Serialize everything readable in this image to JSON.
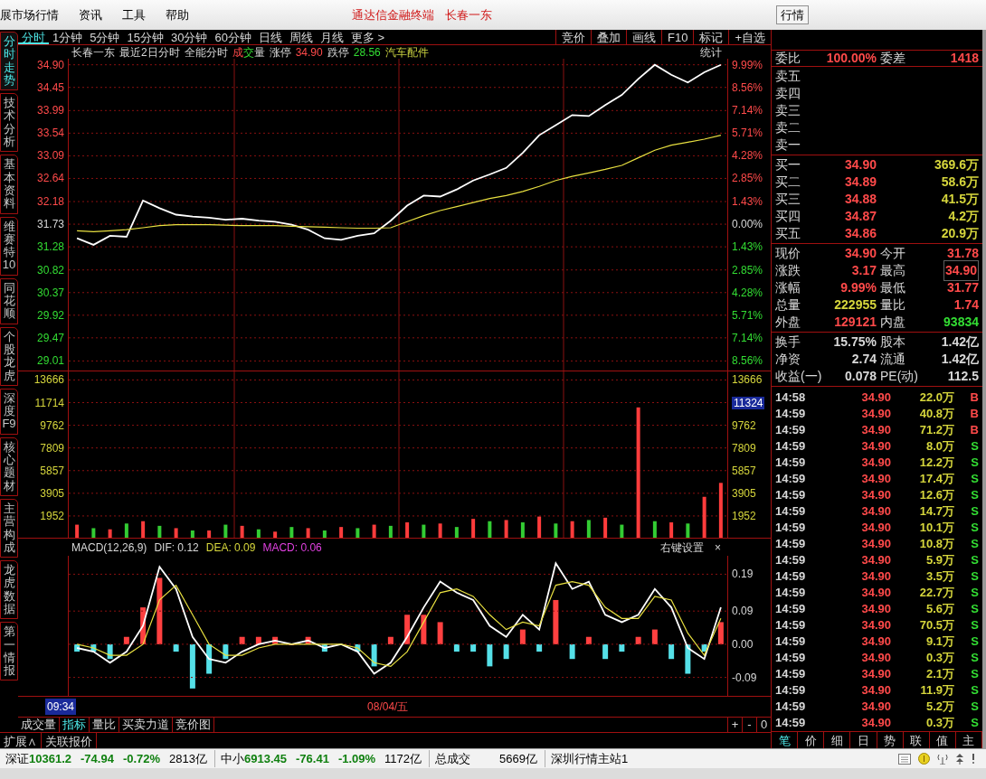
{
  "menu": {
    "items": [
      "展市场行情",
      "资讯",
      "工具",
      "帮助"
    ],
    "center": [
      "通达信金融终端",
      "长春一东"
    ],
    "button": "行情"
  },
  "side_tabs": [
    {
      "label": "分时走势",
      "selected": true
    },
    {
      "label": "技术分析",
      "selected": false
    },
    {
      "label": "基本资料",
      "selected": false
    },
    {
      "label": "维赛特10",
      "selected": false
    },
    {
      "label": "同花顺",
      "selected": false
    },
    {
      "label": "个股龙虎",
      "selected": false
    },
    {
      "label": "深度F9",
      "selected": false
    },
    {
      "label": "核心题材",
      "selected": false
    },
    {
      "label": "主营构成",
      "selected": false
    },
    {
      "label": "龙虎数据",
      "selected": false
    },
    {
      "label": "第一情报",
      "selected": false
    }
  ],
  "period_tabs": [
    {
      "label": "分时",
      "selected": true
    },
    {
      "label": "1分钟",
      "selected": false
    },
    {
      "label": "5分钟",
      "selected": false
    },
    {
      "label": "15分钟",
      "selected": false
    },
    {
      "label": "30分钟",
      "selected": false
    },
    {
      "label": "60分钟",
      "selected": false
    },
    {
      "label": "日线",
      "selected": false
    },
    {
      "label": "周线",
      "selected": false
    },
    {
      "label": "月线",
      "selected": false
    },
    {
      "label": "更多 >",
      "selected": false
    }
  ],
  "tool_buttons": [
    "竞价",
    "叠加",
    "画线",
    "F10",
    "标记",
    "+自选"
  ],
  "info_line": [
    {
      "parts": [
        {
          "text": "长春一东",
          "kind": "flat"
        }
      ]
    },
    {
      "parts": [
        {
          "text": "最近2日分时",
          "kind": "flat"
        }
      ]
    },
    {
      "parts": [
        {
          "text": "全能分时",
          "kind": "flat"
        }
      ]
    },
    {
      "parts": [
        {
          "text": "成",
          "kind": "up"
        },
        {
          "text": "交",
          "kind": "down"
        },
        {
          "text": "量",
          "kind": "flat"
        }
      ]
    },
    {
      "parts": [
        {
          "text": "涨停",
          "kind": "flat"
        }
      ]
    },
    {
      "parts": [
        {
          "text": "34.90",
          "kind": "up"
        }
      ]
    },
    {
      "parts": [
        {
          "text": "跌停",
          "kind": "flat"
        }
      ]
    },
    {
      "parts": [
        {
          "text": "28.56",
          "kind": "down"
        }
      ]
    },
    {
      "parts": [
        {
          "text": "汽车配件",
          "kind": "sector"
        }
      ]
    }
  ],
  "stats_button": "统计",
  "price_panel": {
    "right_axis": [
      {
        "label": "9.99%",
        "kind": "up"
      },
      {
        "label": "8.56%",
        "kind": "up"
      },
      {
        "label": "7.14%",
        "kind": "up"
      },
      {
        "label": "5.71%",
        "kind": "up"
      },
      {
        "label": "4.28%",
        "kind": "up"
      },
      {
        "label": "2.85%",
        "kind": "up"
      },
      {
        "label": "1.43%",
        "kind": "up"
      },
      {
        "label": "0.00%",
        "kind": "flat"
      },
      {
        "label": "1.43%",
        "kind": "down"
      },
      {
        "label": "2.85%",
        "kind": "down"
      },
      {
        "label": "4.28%",
        "kind": "down"
      },
      {
        "label": "5.71%",
        "kind": "down"
      },
      {
        "label": "7.14%",
        "kind": "down"
      },
      {
        "label": "8.56%",
        "kind": "down"
      }
    ],
    "chart_data": {
      "type": "line",
      "grid": true,
      "ylim": [
        28.82,
        35.02
      ],
      "yticks": [
        {
          "value": 34.9,
          "label": "34.90"
        },
        {
          "value": 34.45,
          "label": "34.45"
        },
        {
          "value": 33.99,
          "label": "33.99"
        },
        {
          "value": 33.54,
          "label": "33.54"
        },
        {
          "value": 33.09,
          "label": "33.09"
        },
        {
          "value": 32.64,
          "label": "32.64"
        },
        {
          "value": 32.18,
          "label": "32.18"
        },
        {
          "value": 31.73,
          "label": "31.73"
        },
        {
          "value": 31.28,
          "label": "31.28"
        },
        {
          "value": 30.82,
          "label": "30.82"
        },
        {
          "value": 30.37,
          "label": "30.37"
        },
        {
          "value": 29.92,
          "label": "29.92"
        },
        {
          "value": 29.47,
          "label": "29.47"
        },
        {
          "value": 29.01,
          "label": "29.01"
        }
      ],
      "series": [
        {
          "color": "#ffffff",
          "values": [
            31.45,
            31.32,
            31.5,
            31.48,
            32.2,
            32.05,
            31.92,
            31.88,
            31.86,
            31.82,
            31.84,
            31.8,
            31.78,
            31.72,
            31.62,
            31.45,
            31.42,
            31.5,
            31.55,
            31.8,
            32.1,
            32.3,
            32.28,
            32.42,
            32.6,
            32.72,
            32.85,
            33.15,
            33.5,
            33.7,
            33.9,
            33.88,
            34.1,
            34.3,
            34.62,
            34.9,
            34.7,
            34.55,
            34.75,
            34.9
          ]
        },
        {
          "color": "#e8e040",
          "values": [
            31.6,
            31.58,
            31.6,
            31.62,
            31.66,
            31.7,
            31.72,
            31.72,
            31.72,
            31.71,
            31.7,
            31.7,
            31.7,
            31.69,
            31.68,
            31.67,
            31.66,
            31.65,
            31.65,
            31.66,
            31.78,
            31.9,
            32.0,
            32.08,
            32.16,
            32.24,
            32.3,
            32.38,
            32.48,
            32.6,
            32.68,
            32.75,
            32.82,
            32.9,
            33.05,
            33.2,
            33.3,
            33.36,
            33.42,
            33.5
          ]
        }
      ]
    }
  },
  "volume_panel": {
    "right_axis": [
      {
        "label": "13666",
        "highlighted": false
      },
      {
        "label": "11324",
        "highlighted": true
      },
      {
        "label": "9762",
        "highlighted": false
      },
      {
        "label": "7809",
        "highlighted": false
      },
      {
        "label": "5857",
        "highlighted": false
      },
      {
        "label": "3905",
        "highlighted": false
      },
      {
        "label": "1952",
        "highlighted": false
      }
    ],
    "chart_data": {
      "type": "bar",
      "stacked": true,
      "grid": true,
      "ylim": [
        0,
        14400
      ],
      "yticks": [
        {
          "value": 13666,
          "label": "13666"
        },
        {
          "value": 11714,
          "label": "11714"
        },
        {
          "value": 9762,
          "label": "9762"
        },
        {
          "value": 7809,
          "label": "7809"
        },
        {
          "value": 5857,
          "label": "5857"
        },
        {
          "value": 3905,
          "label": "3905"
        },
        {
          "value": 1952,
          "label": "1952"
        }
      ],
      "series": [
        {
          "color": "#ff3c3c",
          "values": [
            1200,
            null,
            800,
            null,
            1500,
            null,
            900,
            null,
            700,
            null,
            1100,
            null,
            600,
            null,
            900,
            null,
            1000,
            null,
            1200,
            null,
            1400,
            null,
            1300,
            null,
            1700,
            null,
            1600,
            null,
            1900,
            null,
            1500,
            null,
            1800,
            null,
            11300,
            null,
            1400,
            null,
            3600,
            4800
          ]
        },
        {
          "color": "#33cc33",
          "values": [
            null,
            900,
            null,
            1300,
            null,
            1100,
            null,
            700,
            null,
            1200,
            null,
            800,
            null,
            1000,
            null,
            700,
            null,
            900,
            null,
            1100,
            null,
            1200,
            null,
            1000,
            null,
            1500,
            null,
            1400,
            null,
            1300,
            null,
            1600,
            null,
            1200,
            null,
            1500,
            null,
            1300,
            null,
            null
          ]
        }
      ]
    }
  },
  "macd_panel": {
    "title": "MACD(12,26,9)",
    "readings": [
      {
        "text": "DIF: 0.12",
        "kind": "flat"
      },
      {
        "text": "DEA: 0.09",
        "kind": "volume"
      },
      {
        "text": "MACD: 0.06",
        "kind": "magenta"
      }
    ],
    "settings": "右键设置",
    "close": "×",
    "chart_data": {
      "type": "line",
      "grid": true,
      "ylim": [
        -0.14,
        0.24
      ],
      "yticks": [
        {
          "value": 0.19,
          "label": "0.19"
        },
        {
          "value": 0.09,
          "label": "0.09"
        },
        {
          "value": 0,
          "label": "0.00"
        },
        {
          "value": -0.09,
          "label": "-0.09"
        }
      ],
      "series": [
        {
          "color": "#ffffff",
          "values": [
            -0.01,
            -0.02,
            -0.05,
            -0.02,
            0.05,
            0.21,
            0.15,
            0.02,
            -0.04,
            -0.05,
            -0.02,
            0.0,
            0.01,
            0.0,
            0.01,
            -0.01,
            0.0,
            -0.02,
            -0.08,
            -0.05,
            0.02,
            0.1,
            0.17,
            0.14,
            0.12,
            0.05,
            0.02,
            0.08,
            0.04,
            0.22,
            0.15,
            0.17,
            0.08,
            0.06,
            0.08,
            0.15,
            0.1,
            -0.01,
            -0.04,
            0.1
          ]
        },
        {
          "color": "#e8e040",
          "values": [
            0.0,
            -0.01,
            -0.03,
            -0.03,
            0.0,
            0.12,
            0.16,
            0.08,
            0.0,
            -0.03,
            -0.03,
            -0.01,
            0.0,
            0.0,
            0.0,
            0.0,
            0.0,
            -0.01,
            -0.05,
            -0.06,
            -0.02,
            0.06,
            0.14,
            0.15,
            0.13,
            0.08,
            0.04,
            0.06,
            0.05,
            0.16,
            0.17,
            0.16,
            0.1,
            0.07,
            0.07,
            0.13,
            0.12,
            0.03,
            -0.03,
            0.07
          ]
        }
      ]
    }
  },
  "time_axis": {
    "cursor": "09:34",
    "date": "08/04/五"
  },
  "bottom_tabs": [
    {
      "label": "成交量",
      "selected": false
    },
    {
      "label": "指标",
      "selected": true
    },
    {
      "label": "量比",
      "selected": false
    },
    {
      "label": "买卖力道",
      "selected": false
    },
    {
      "label": "竞价图",
      "selected": false
    }
  ],
  "zoom_buttons": [
    "+",
    "-",
    "0"
  ],
  "extension_tabs": [
    "扩展∧",
    "关联报价"
  ],
  "order_book": {
    "ratio": [
      {
        "label": "委比",
        "value": "100.00%"
      },
      {
        "label": "委差",
        "value": "1418"
      }
    ],
    "sell": [
      "卖五",
      "卖四",
      "卖三",
      "卖二",
      "卖一"
    ],
    "buy": [
      {
        "label": "买一",
        "price": "34.90",
        "volume": "369.6万"
      },
      {
        "label": "买二",
        "price": "34.89",
        "volume": "58.6万"
      },
      {
        "label": "买三",
        "price": "34.88",
        "volume": "41.5万"
      },
      {
        "label": "买四",
        "price": "34.87",
        "volume": "4.2万"
      },
      {
        "label": "买五",
        "price": "34.86",
        "volume": "20.9万"
      }
    ]
  },
  "quote": [
    [
      {
        "label": "现价",
        "value": "34.90",
        "kind": "up",
        "boxed": false
      },
      {
        "label": "今开",
        "value": "31.78",
        "kind": "up",
        "boxed": false
      }
    ],
    [
      {
        "label": "涨跌",
        "value": "3.17",
        "kind": "up",
        "boxed": false
      },
      {
        "label": "最高",
        "value": "34.90",
        "kind": "up",
        "boxed": true
      }
    ],
    [
      {
        "label": "涨幅",
        "value": "9.99%",
        "kind": "up",
        "boxed": false
      },
      {
        "label": "最低",
        "value": "31.77",
        "kind": "up",
        "boxed": false
      }
    ],
    [
      {
        "label": "总量",
        "value": "222955",
        "kind": "volume",
        "boxed": false
      },
      {
        "label": "量比",
        "value": "1.74",
        "kind": "up",
        "boxed": false
      }
    ],
    [
      {
        "label": "外盘",
        "value": "129121",
        "kind": "up",
        "boxed": false
      },
      {
        "label": "内盘",
        "value": "93834",
        "kind": "down",
        "boxed": false
      }
    ]
  ],
  "fundamentals": [
    [
      {
        "label": "换手",
        "value": "15.75%"
      },
      {
        "label": "股本",
        "value": "1.42亿"
      }
    ],
    [
      {
        "label": "净资",
        "value": "2.74"
      },
      {
        "label": "流通",
        "value": "1.42亿"
      }
    ],
    [
      {
        "label": "收益(一)",
        "value": "0.078"
      },
      {
        "label": "PE(动)",
        "value": "112.5"
      }
    ]
  ],
  "ticks": [
    {
      "time": "14:58",
      "price": "34.90",
      "volume": "22.0万",
      "side": "B"
    },
    {
      "time": "14:59",
      "price": "34.90",
      "volume": "40.8万",
      "side": "B"
    },
    {
      "time": "14:59",
      "price": "34.90",
      "volume": "71.2万",
      "side": "B"
    },
    {
      "time": "14:59",
      "price": "34.90",
      "volume": "8.0万",
      "side": "S"
    },
    {
      "time": "14:59",
      "price": "34.90",
      "volume": "12.2万",
      "side": "S"
    },
    {
      "time": "14:59",
      "price": "34.90",
      "volume": "17.4万",
      "side": "S"
    },
    {
      "time": "14:59",
      "price": "34.90",
      "volume": "12.6万",
      "side": "S"
    },
    {
      "time": "14:59",
      "price": "34.90",
      "volume": "14.7万",
      "side": "S"
    },
    {
      "time": "14:59",
      "price": "34.90",
      "volume": "10.1万",
      "side": "S"
    },
    {
      "time": "14:59",
      "price": "34.90",
      "volume": "10.8万",
      "side": "S"
    },
    {
      "time": "14:59",
      "price": "34.90",
      "volume": "5.9万",
      "side": "S"
    },
    {
      "time": "14:59",
      "price": "34.90",
      "volume": "3.5万",
      "side": "S"
    },
    {
      "time": "14:59",
      "price": "34.90",
      "volume": "22.7万",
      "side": "S"
    },
    {
      "time": "14:59",
      "price": "34.90",
      "volume": "5.6万",
      "side": "S"
    },
    {
      "time": "14:59",
      "price": "34.90",
      "volume": "70.5万",
      "side": "S"
    },
    {
      "time": "14:59",
      "price": "34.90",
      "volume": "9.1万",
      "side": "S"
    },
    {
      "time": "14:59",
      "price": "34.90",
      "volume": "0.3万",
      "side": "S"
    },
    {
      "time": "14:59",
      "price": "34.90",
      "volume": "2.1万",
      "side": "S"
    },
    {
      "time": "14:59",
      "price": "34.90",
      "volume": "11.9万",
      "side": "S"
    },
    {
      "time": "14:59",
      "price": "34.90",
      "volume": "5.2万",
      "side": "S"
    },
    {
      "time": "14:59",
      "price": "34.90",
      "volume": "0.3万",
      "side": "S"
    }
  ],
  "right_tabs": [
    {
      "label": "笔",
      "selected": true
    },
    {
      "label": "价",
      "selected": false
    },
    {
      "label": "细",
      "selected": false
    },
    {
      "label": "日",
      "selected": false
    },
    {
      "label": "势",
      "selected": false
    },
    {
      "label": "联",
      "selected": false
    },
    {
      "label": "值",
      "selected": false
    },
    {
      "label": "主",
      "selected": false
    }
  ],
  "status_bar": {
    "markets": [
      {
        "name": "深证",
        "index": "10361.2",
        "change": "-74.94",
        "pct": "-0.72%",
        "amount": "2813亿"
      },
      {
        "name": "中小",
        "index": "6913.45",
        "change": "-76.41",
        "pct": "-1.09%",
        "amount": "1172亿"
      }
    ],
    "total_label": "总成交",
    "total": "5669亿",
    "server": "深圳行情主站1"
  }
}
